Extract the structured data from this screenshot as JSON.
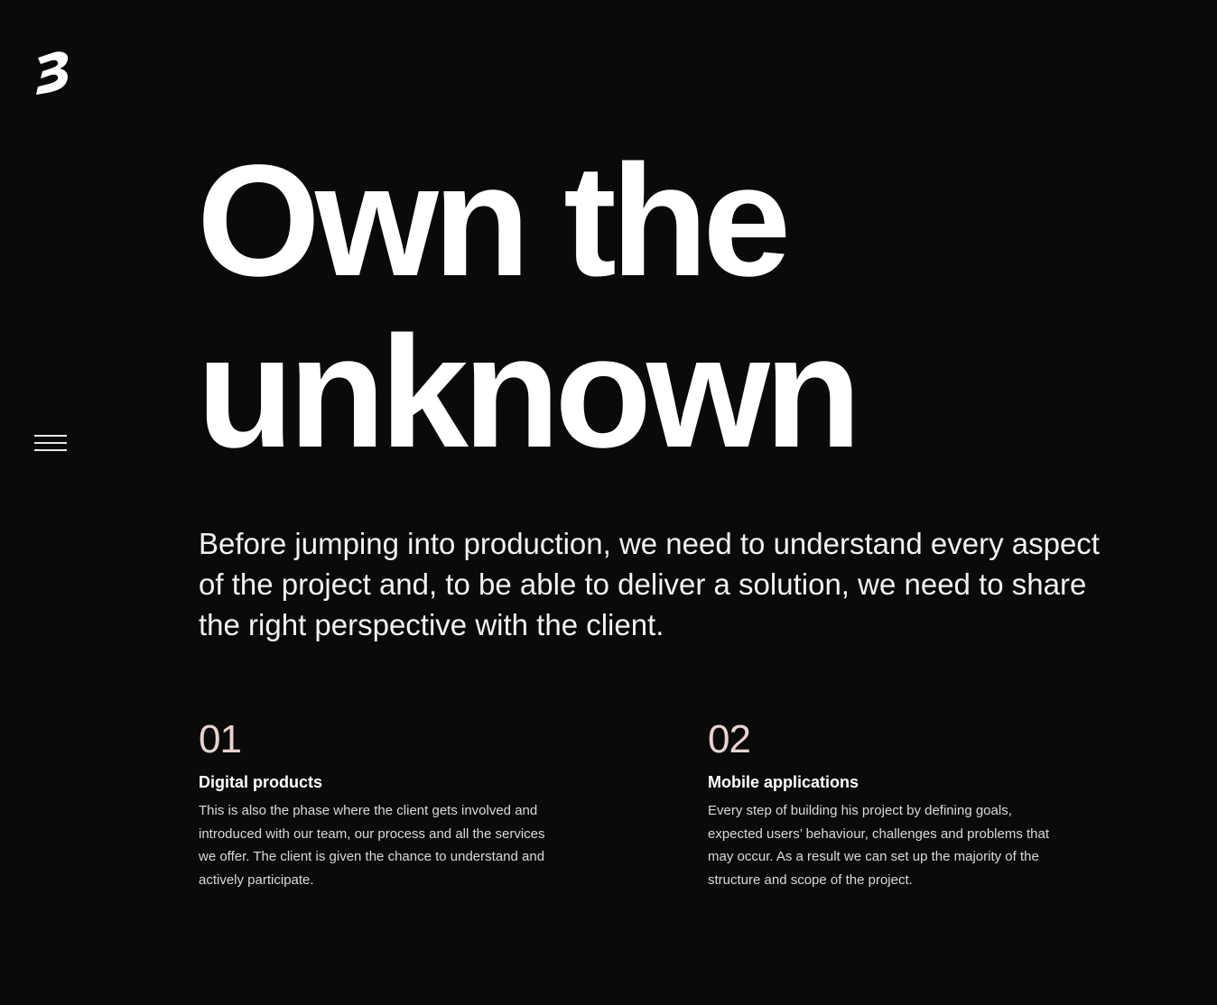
{
  "brand": {
    "logo_icon": "b-logo-icon",
    "logo_letter": "B"
  },
  "nav": {
    "menu_icon": "hamburger-menu-icon"
  },
  "hero": {
    "title_line1": "Own the",
    "title_line2": "unknown"
  },
  "intro": {
    "text": "Before jumping into production, we need to understand every aspect of the project and, to be able to deliver a solution, we need to share the right perspective with the client."
  },
  "features": [
    {
      "number": "01",
      "title": "Digital products",
      "text": "This is also the phase where the client gets involved and introduced with our team, our process and all the services we offer. The client is given the chance to understand and actively participate."
    },
    {
      "number": "02",
      "title": "Mobile applications",
      "text": "Every step of building his project by defining goals, expected users’ behaviour, challenges and problems that may occur. As a result we can set up the majority of the structure and scope of the project."
    }
  ],
  "colors": {
    "background": "#0a0a0a",
    "text": "#ffffff",
    "number_accent": "#e9d3cf"
  }
}
